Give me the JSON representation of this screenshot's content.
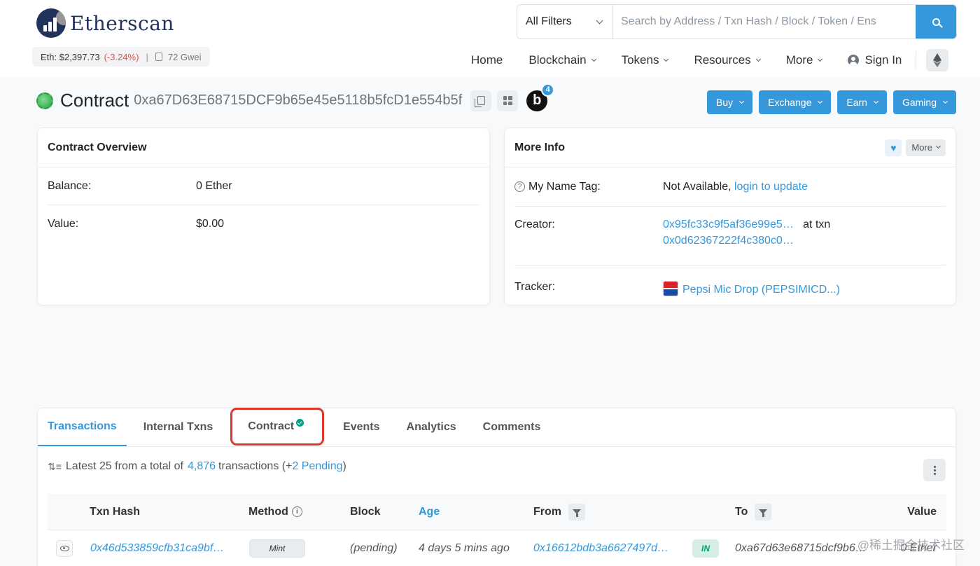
{
  "header": {
    "logo_text": "Etherscan",
    "eth_price_label": "Eth: $2,397.73",
    "eth_change": "(-3.24%)",
    "separator": "|",
    "gas": "72 Gwei",
    "filter_label": "All Filters",
    "search_placeholder": "Search by Address / Txn Hash / Block / Token / Ens",
    "nav": {
      "home": "Home",
      "blockchain": "Blockchain",
      "tokens": "Tokens",
      "resources": "Resources",
      "more": "More",
      "sign_in": "Sign In"
    }
  },
  "title": {
    "label": "Contract",
    "address": "0xa67D63E68715DCF9b65e45e5118b5fcD1e554b5f",
    "badge_letter": "b",
    "badge_count": "4"
  },
  "sponsor_buttons": [
    "Buy",
    "Exchange",
    "Earn",
    "Gaming"
  ],
  "overview": {
    "title": "Contract Overview",
    "balance_label": "Balance:",
    "balance_value": "0 Ether",
    "value_label": "Value:",
    "value_value": "$0.00"
  },
  "more_info": {
    "title": "More Info",
    "more_button": "More",
    "name_tag_label": "My Name Tag:",
    "name_tag_value": "Not Available,",
    "name_tag_link": "login to update",
    "creator_label": "Creator:",
    "creator_address": "0x95fc33c9f5af36e99e5…",
    "creator_at": "at txn",
    "creator_txn": "0x0d62367222f4c380c0…",
    "tracker_label": "Tracker:",
    "tracker_value": "Pepsi Mic Drop (PEPSIMICD...)"
  },
  "tabs": {
    "transactions": "Transactions",
    "internal": "Internal Txns",
    "contract": "Contract",
    "events": "Events",
    "analytics": "Analytics",
    "comments": "Comments"
  },
  "summary": {
    "prefix": "Latest 25 from a total of",
    "total": "4,876",
    "mid": "transactions (+",
    "pending": "2 Pending",
    "suffix": ")"
  },
  "table": {
    "headers": {
      "hash": "Txn Hash",
      "method": "Method",
      "block": "Block",
      "age": "Age",
      "from": "From",
      "to": "To",
      "value": "Value"
    },
    "rows": [
      {
        "hash": "0x46d533859cfb31ca9bf…",
        "method": "Mint",
        "block": "(pending)",
        "age": "4 days 5 mins ago",
        "from": "0x16612bdb3a6627497d…",
        "direction": "IN",
        "to": "0xa67d63e68715dcf9b6…",
        "value": "0 Ether"
      }
    ]
  },
  "watermark": "@稀土掘金技术社区",
  "colors": {
    "accent": "#3498db",
    "navy": "#21325b",
    "negative": "#d9534f",
    "highlight_outline": "#e0382c",
    "success": "#00a186"
  }
}
